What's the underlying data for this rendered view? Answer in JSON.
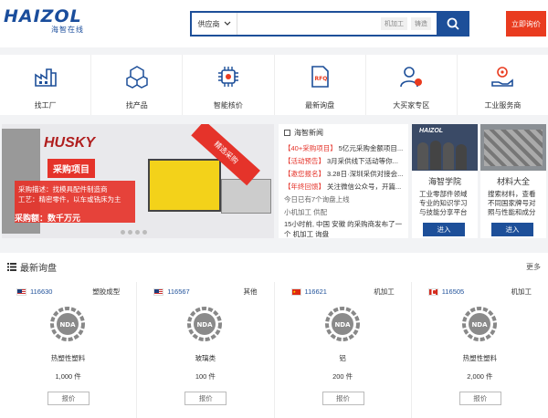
{
  "header": {
    "logo_text": "HAIZOL",
    "logo_sub": "海智在线",
    "search_select": "供应商",
    "search_placeholder": "",
    "hot_tags": [
      "机加工",
      "铸造"
    ],
    "quote_button": "立即询价"
  },
  "nav": [
    {
      "label": "找工厂",
      "icon": "factory-icon"
    },
    {
      "label": "找产品",
      "icon": "boxes-icon"
    },
    {
      "label": "智能核价",
      "icon": "chip-icon"
    },
    {
      "label": "最新询盘",
      "icon": "rfq-doc-icon"
    },
    {
      "label": "大买家专区",
      "icon": "buyer-icon"
    },
    {
      "label": "工业服务商",
      "icon": "service-hand-icon"
    }
  ],
  "hero": {
    "brand": "HUSKY",
    "corner_text": "精选采购",
    "title": "采购项目",
    "desc_line1": "采购描述：找模具配件制造商",
    "desc_line2": "工艺：精密零件，以车或铣床为主",
    "amount": "采购额：数千万元"
  },
  "news": {
    "title": "海智新闻",
    "items": [
      {
        "tag": "【40+采购项目】",
        "text": "5亿元采购金额项目..."
      },
      {
        "tag": "【活动预告】",
        "text": "3月采供线下活动等你..."
      },
      {
        "tag": "【邀您报名】",
        "text": "3.28日·深圳采供对接会..."
      },
      {
        "tag": "【年终回馈】",
        "text": "关注微信公众号，开篇..."
      }
    ],
    "mid_line": "今日已有7个询盘上线",
    "mid_line2": "小机加工 供配",
    "bottom": "15小时前, 中国 安徽 的采购商发布了一个 机加工 询盘"
  },
  "cards": [
    {
      "caption": "海智学院",
      "text": "工业零部件领域专业的知识学习与技能分享平台",
      "button": "进入"
    },
    {
      "caption": "材料大全",
      "text": "搜索材料，查看不同国家牌号对照与性能和成分",
      "button": "进入"
    }
  ],
  "section": {
    "title": "最新询盘",
    "more": "更多",
    "items": [
      {
        "flag": "us",
        "id": "116630",
        "category": "塑胶成型",
        "name": "热塑性塑料",
        "qty": "1,000 件",
        "button": "报价"
      },
      {
        "flag": "us",
        "id": "116567",
        "category": "其他",
        "name": "玻璃类",
        "qty": "100 件",
        "button": "报价"
      },
      {
        "flag": "cn",
        "id": "116621",
        "category": "机加工",
        "name": "铝",
        "qty": "200 件",
        "button": "报价"
      },
      {
        "flag": "ca",
        "id": "116505",
        "category": "机加工",
        "name": "热塑性塑料",
        "qty": "2,000 件",
        "button": "报价"
      }
    ],
    "nda_label": "NDA"
  }
}
